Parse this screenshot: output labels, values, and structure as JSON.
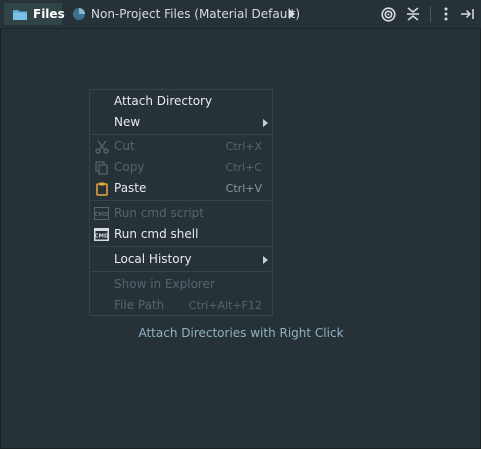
{
  "toolbar": {
    "tabs": [
      {
        "label": "Files",
        "icon": "folder-icon"
      },
      {
        "label": "Non-Project Files (Material Default)",
        "icon": "pie-chart-icon"
      }
    ],
    "buttons": [
      {
        "name": "more-tabs-arrow-icon"
      },
      {
        "name": "target-icon"
      },
      {
        "name": "collapse-all-icon"
      },
      {
        "name": "more-options-icon"
      },
      {
        "name": "hide-panel-icon"
      }
    ]
  },
  "context_menu": {
    "items": [
      {
        "label": "Attach Directory",
        "shortcut": "",
        "enabled": true,
        "submenu": false
      },
      {
        "label": "New",
        "shortcut": "",
        "enabled": true,
        "submenu": true
      },
      {
        "label": "Cut",
        "shortcut": "Ctrl+X",
        "enabled": false,
        "icon": "scissors-icon"
      },
      {
        "label": "Copy",
        "shortcut": "Ctrl+C",
        "enabled": false,
        "icon": "copy-icon"
      },
      {
        "label": "Paste",
        "shortcut": "Ctrl+V",
        "enabled": true,
        "icon": "clipboard-icon"
      },
      {
        "label": "Run cmd script",
        "shortcut": "",
        "enabled": false,
        "icon": "cmd-icon"
      },
      {
        "label": "Run cmd shell",
        "shortcut": "",
        "enabled": true,
        "icon": "cmd-icon"
      },
      {
        "label": "Local History",
        "shortcut": "",
        "enabled": true,
        "submenu": true
      },
      {
        "label": "Show in Explorer",
        "shortcut": "",
        "enabled": false
      },
      {
        "label": "File Path",
        "shortcut": "Ctrl+Alt+F12",
        "enabled": false
      }
    ]
  },
  "empty_hint": "Attach Directories with Right Click",
  "colors": {
    "background": "#263238",
    "active_tab": "#314549",
    "hint_text": "#8fb3c2",
    "disabled_text": "#55656d"
  }
}
